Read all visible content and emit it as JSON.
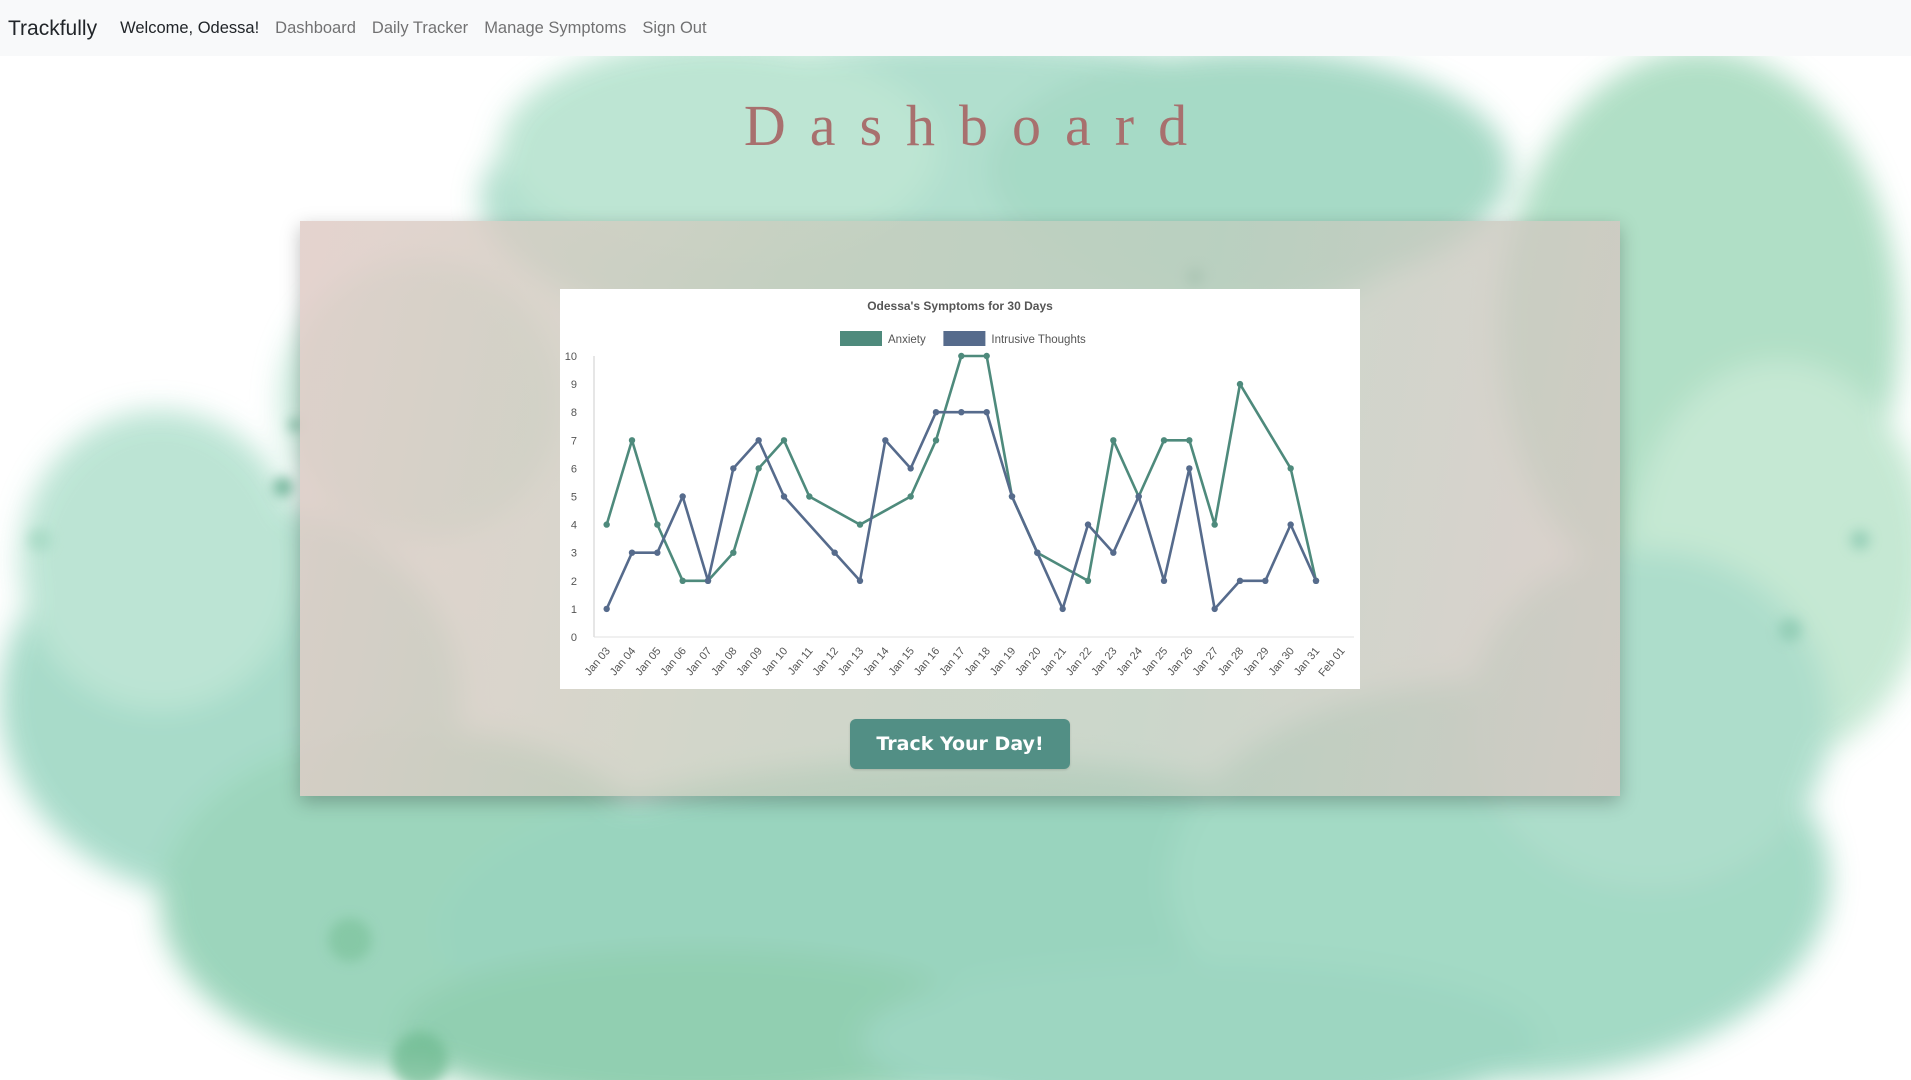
{
  "navbar": {
    "brand": "Trackfully",
    "welcome": "Welcome, Odessa!",
    "links": [
      "Dashboard",
      "Daily Tracker",
      "Manage Symptoms",
      "Sign Out"
    ]
  },
  "page": {
    "title": "Dashboard",
    "track_button": "Track Your Day!"
  },
  "colors": {
    "title": "#a8706e",
    "button": "#528f85",
    "anxiety": "#4e8a7c",
    "intrusive": "#566b8c"
  },
  "chart_data": {
    "type": "line",
    "title": "Odessa's Symptoms for 30 Days",
    "legend_position": "top",
    "grid": false,
    "ylim": [
      0,
      10
    ],
    "yticks": [
      0,
      1,
      2,
      3,
      4,
      5,
      6,
      7,
      8,
      9,
      10
    ],
    "categories": [
      "Jan 03",
      "Jan 04",
      "Jan 05",
      "Jan 06",
      "Jan 07",
      "Jan 08",
      "Jan 09",
      "Jan 10",
      "Jan 11",
      "Jan 12",
      "Jan 13",
      "Jan 14",
      "Jan 15",
      "Jan 16",
      "Jan 17",
      "Jan 18",
      "Jan 19",
      "Jan 20",
      "Jan 21",
      "Jan 22",
      "Jan 23",
      "Jan 24",
      "Jan 25",
      "Jan 26",
      "Jan 27",
      "Jan 28",
      "Jan 29",
      "Jan 30",
      "Jan 31",
      "Feb 01"
    ],
    "series": [
      {
        "name": "Anxiety",
        "color": "#4e8a7c",
        "points": [
          [
            "Jan 03",
            4
          ],
          [
            "Jan 04",
            7
          ],
          [
            "Jan 05",
            4
          ],
          [
            "Jan 06",
            2
          ],
          [
            "Jan 07",
            2
          ],
          [
            "Jan 08",
            3
          ],
          [
            "Jan 09",
            6
          ],
          [
            "Jan 10",
            7
          ],
          [
            "Jan 11",
            5
          ],
          [
            "Jan 13",
            4
          ],
          [
            "Jan 15",
            5
          ],
          [
            "Jan 16",
            7
          ],
          [
            "Jan 17",
            10
          ],
          [
            "Jan 18",
            10
          ],
          [
            "Jan 19",
            5
          ],
          [
            "Jan 20",
            3
          ],
          [
            "Jan 22",
            2
          ],
          [
            "Jan 23",
            7
          ],
          [
            "Jan 24",
            5
          ],
          [
            "Jan 25",
            7
          ],
          [
            "Jan 26",
            7
          ],
          [
            "Jan 27",
            4
          ],
          [
            "Jan 28",
            9
          ],
          [
            "Jan 30",
            6
          ],
          [
            "Jan 31",
            2
          ]
        ]
      },
      {
        "name": "Intrusive Thoughts",
        "color": "#566b8c",
        "points": [
          [
            "Jan 03",
            1
          ],
          [
            "Jan 04",
            3
          ],
          [
            "Jan 05",
            3
          ],
          [
            "Jan 06",
            5
          ],
          [
            "Jan 07",
            2
          ],
          [
            "Jan 08",
            6
          ],
          [
            "Jan 09",
            7
          ],
          [
            "Jan 10",
            5
          ],
          [
            "Jan 12",
            3
          ],
          [
            "Jan 13",
            2
          ],
          [
            "Jan 14",
            7
          ],
          [
            "Jan 15",
            6
          ],
          [
            "Jan 16",
            8
          ],
          [
            "Jan 17",
            8
          ],
          [
            "Jan 18",
            8
          ],
          [
            "Jan 19",
            5
          ],
          [
            "Jan 20",
            3
          ],
          [
            "Jan 21",
            1
          ],
          [
            "Jan 22",
            4
          ],
          [
            "Jan 23",
            3
          ],
          [
            "Jan 24",
            5
          ],
          [
            "Jan 25",
            2
          ],
          [
            "Jan 26",
            6
          ],
          [
            "Jan 27",
            1
          ],
          [
            "Jan 28",
            2
          ],
          [
            "Jan 29",
            2
          ],
          [
            "Jan 30",
            4
          ],
          [
            "Jan 31",
            2
          ]
        ]
      }
    ]
  }
}
